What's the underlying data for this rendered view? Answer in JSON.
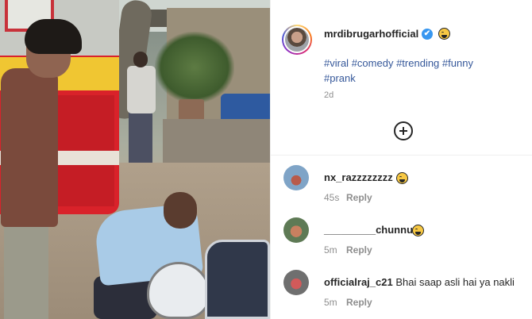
{
  "post": {
    "username": "mrdibrugarhofficial",
    "verified_symbol": "✔",
    "caption_tags": [
      "#viral",
      "#comedy",
      "#trending",
      "#funny",
      "#prank"
    ],
    "time": "2d"
  },
  "comments": [
    {
      "username": "nx_razzzzzzzz",
      "text": "",
      "time": "45s",
      "reply_label": "Reply"
    },
    {
      "username": "_________chunnu",
      "text": "",
      "time": "5m",
      "reply_label": "Reply"
    },
    {
      "username": "officialraj_c21",
      "text": "Bhai saap asli hai ya nakli",
      "time": "5m",
      "reply_label": "Reply"
    }
  ],
  "colors": {
    "verified": "#3897f0",
    "hashtag": "#36589a",
    "meta": "#8e8e8e"
  },
  "icons": [
    "verified-badge-icon",
    "grinning-emoji-icon",
    "add-comment-icon"
  ]
}
